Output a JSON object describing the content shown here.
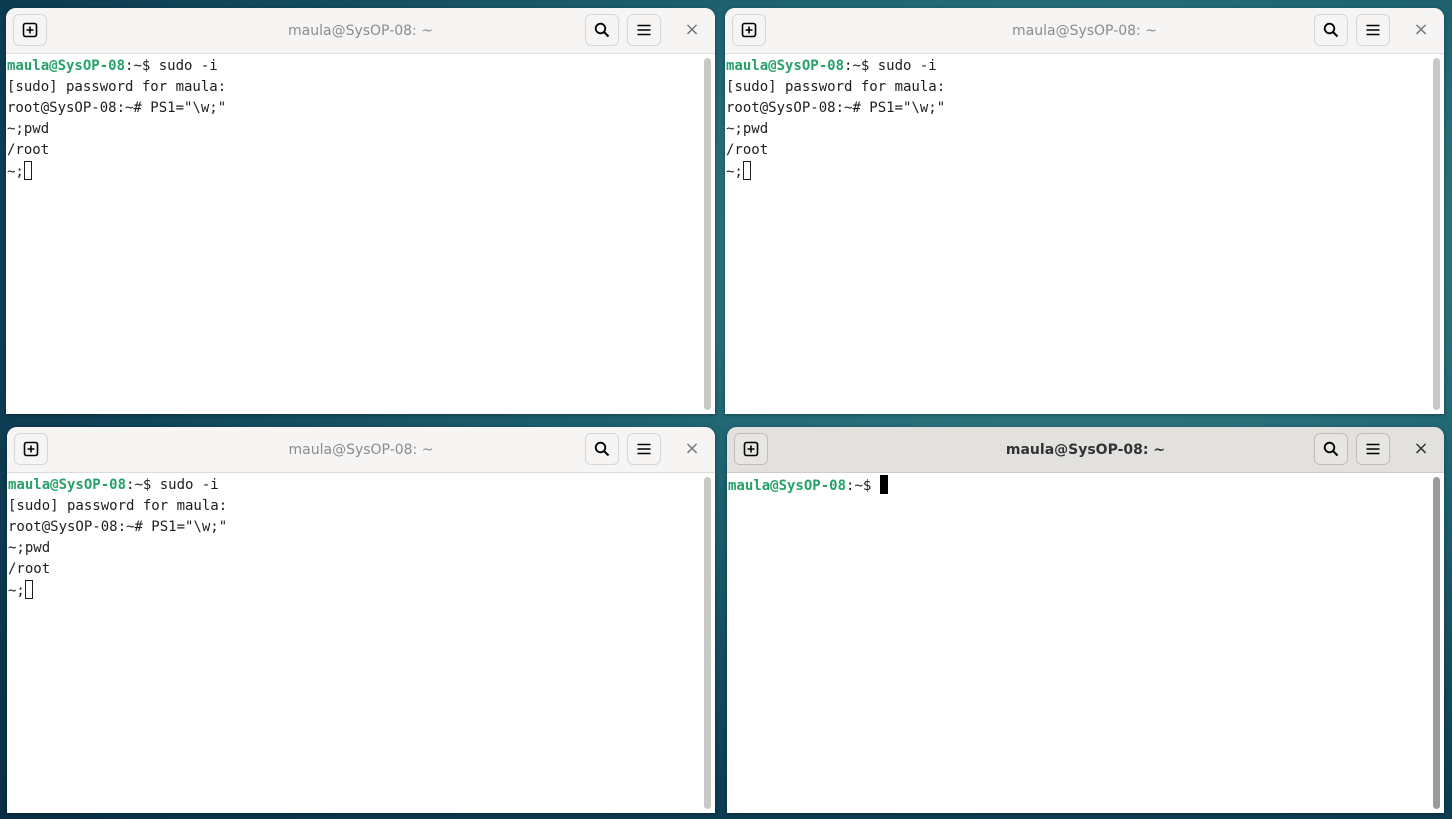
{
  "windows": [
    {
      "id": "tl",
      "title": "maula@SysOP-08: ~",
      "focused": false,
      "lines": [
        [
          {
            "t": "maula@SysOP-08",
            "c": "pu"
          },
          {
            "t": ":~$ sudo -i"
          }
        ],
        [
          {
            "t": "[sudo] password for maula:"
          }
        ],
        [
          {
            "t": "root@SysOP-08:~# PS1=\"\\w;\""
          }
        ],
        [
          {
            "t": "~;pwd"
          }
        ],
        [
          {
            "t": "/root"
          }
        ],
        [
          {
            "t": "~;"
          },
          {
            "cursor": "hollow"
          }
        ]
      ]
    },
    {
      "id": "tr",
      "title": "maula@SysOP-08: ~",
      "focused": false,
      "lines": [
        [
          {
            "t": "maula@SysOP-08",
            "c": "pu"
          },
          {
            "t": ":~$ sudo -i"
          }
        ],
        [
          {
            "t": "[sudo] password for maula:"
          }
        ],
        [
          {
            "t": "root@SysOP-08:~# PS1=\"\\w;\""
          }
        ],
        [
          {
            "t": "~;pwd"
          }
        ],
        [
          {
            "t": "/root"
          }
        ],
        [
          {
            "t": "~;"
          },
          {
            "cursor": "hollow"
          }
        ]
      ]
    },
    {
      "id": "bl",
      "title": "maula@SysOP-08: ~",
      "focused": false,
      "lines": [
        [
          {
            "t": "maula@SysOP-08",
            "c": "pu"
          },
          {
            "t": ":~$ sudo -i"
          }
        ],
        [
          {
            "t": "[sudo] password for maula:"
          }
        ],
        [
          {
            "t": "root@SysOP-08:~# PS1=\"\\w;\""
          }
        ],
        [
          {
            "t": "~;pwd"
          }
        ],
        [
          {
            "t": "/root"
          }
        ],
        [
          {
            "t": "~;"
          },
          {
            "cursor": "hollow"
          }
        ]
      ]
    },
    {
      "id": "br",
      "title": "maula@SysOP-08: ~",
      "focused": true,
      "lines": [
        [
          {
            "t": "maula@SysOP-08",
            "c": "pu"
          },
          {
            "t": ":~$ "
          },
          {
            "cursor": "solid"
          }
        ]
      ]
    }
  ],
  "icons": {
    "new_tab": "new-tab-icon",
    "search": "search-icon",
    "menu": "hamburger-menu-icon",
    "close": "close-icon"
  },
  "close_glyph": "×",
  "colors": {
    "prompt_user_host": "#26a269",
    "desktop_bg": "#1f6472"
  }
}
